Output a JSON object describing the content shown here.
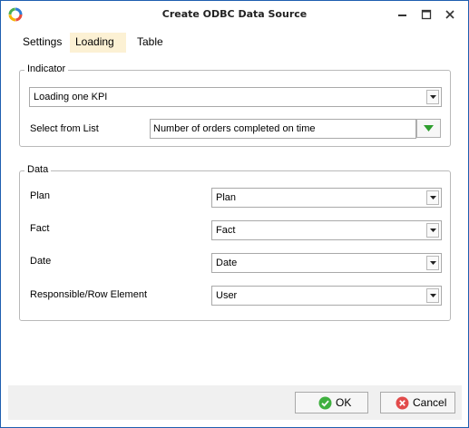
{
  "window": {
    "title": "Create ODBC Data Source"
  },
  "tabs": [
    {
      "label": "Settings",
      "active": false
    },
    {
      "label": "Loading",
      "active": true
    },
    {
      "label": "Table",
      "active": false
    }
  ],
  "indicator": {
    "legend": "Indicator",
    "mode_value": "Loading one KPI",
    "select_label": "Select from List",
    "select_value": "Number of orders completed on time"
  },
  "data_group": {
    "legend": "Data",
    "rows": [
      {
        "label": "Plan",
        "value": "Plan"
      },
      {
        "label": "Fact",
        "value": "Fact"
      },
      {
        "label": "Date",
        "value": "Date"
      },
      {
        "label": "Responsible/Row Element",
        "value": "User"
      }
    ]
  },
  "buttons": {
    "ok": "OK",
    "cancel": "Cancel"
  },
  "colors": {
    "accent": "#1f5fb0",
    "active_tab": "#fcf1d4",
    "ok_green": "#3fb03f",
    "cancel_red": "#e24b4b"
  }
}
